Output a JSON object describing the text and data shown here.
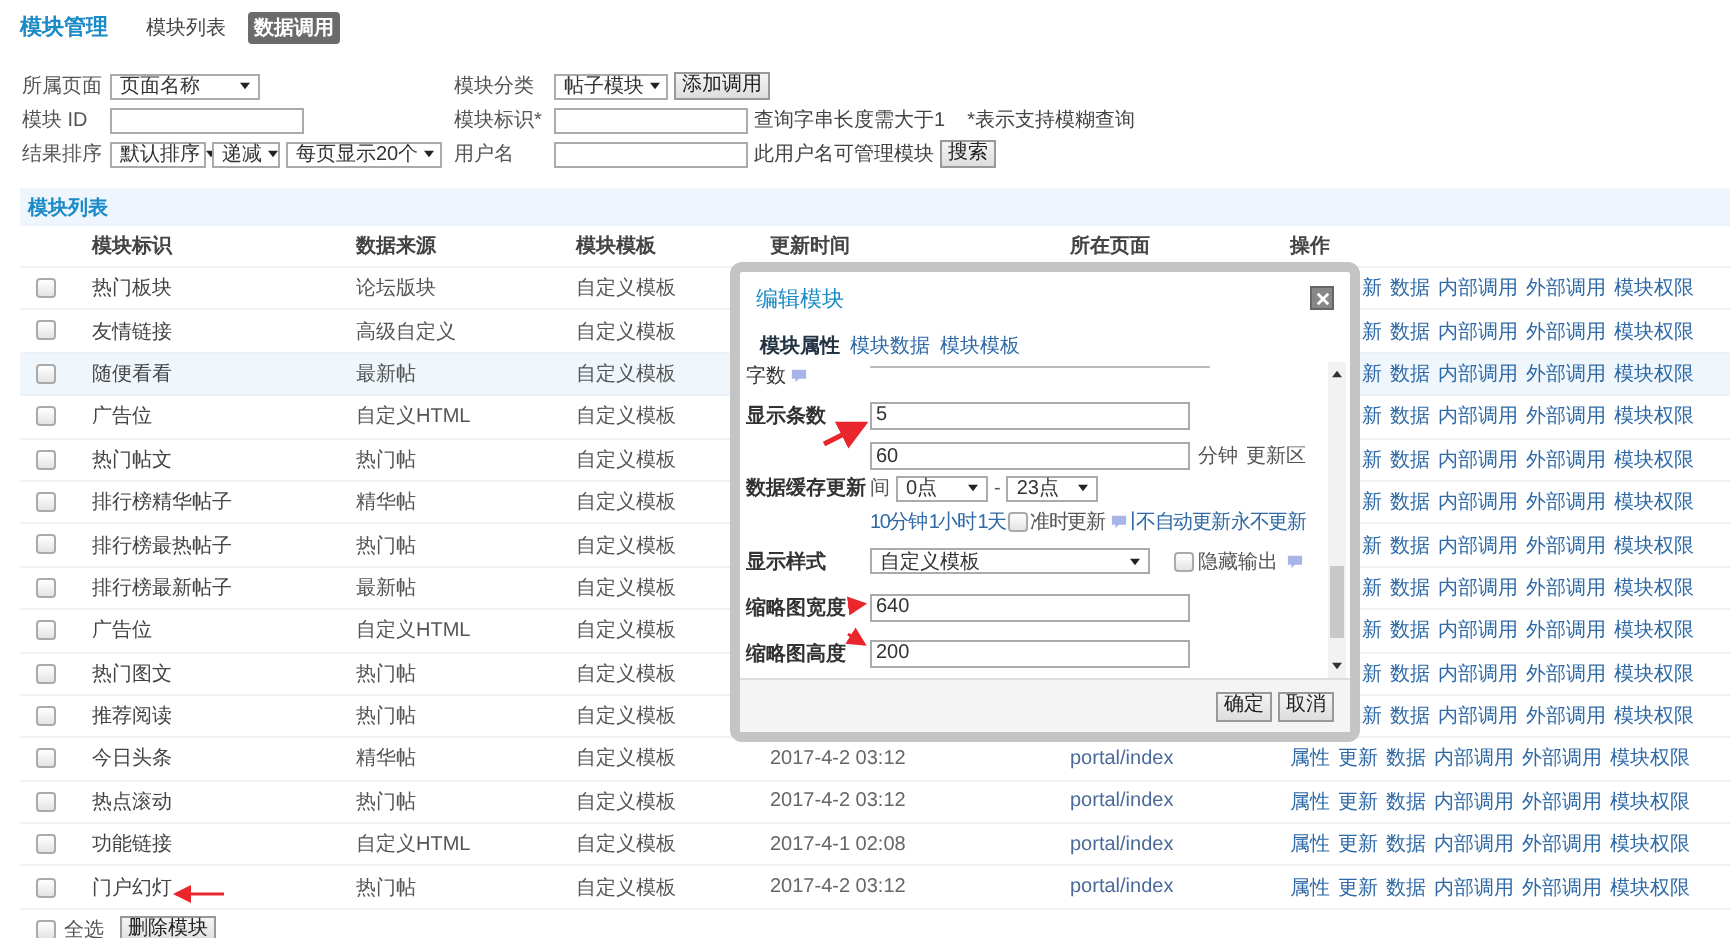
{
  "header": {
    "title": "模块管理",
    "tabs": [
      {
        "label": "模块列表",
        "selected": false
      },
      {
        "label": "数据调用",
        "selected": true
      }
    ]
  },
  "filters": {
    "page_label": "所属页面",
    "page_value": "页面名称",
    "category_label": "模块分类",
    "category_value": "帖子模块",
    "add_button": "添加调用",
    "id_label": "模块 ID",
    "key_label": "模块标识*",
    "key_hint": "查询字串长度需大于1",
    "key_hint_2": "*表示支持模糊查询",
    "sort_label": "结果排序",
    "order_by": "默认排序",
    "direction": "递减",
    "per_page": "每页显示20个",
    "user_label": "用户名",
    "user_hint": "此用户名可管理模块",
    "search_button": "搜索"
  },
  "list": {
    "title": "模块列表",
    "columns": [
      "模块标识",
      "数据来源",
      "模块模板",
      "更新时间",
      "所在页面",
      "操作"
    ],
    "rows": [
      {
        "checked": false,
        "highlighted": false,
        "covered": true,
        "name": "热门板块",
        "source": "论坛版块",
        "template": "自定义模板",
        "actions": [
          "新",
          "数据",
          "内部调用",
          "外部调用",
          "模块权限"
        ]
      },
      {
        "checked": false,
        "highlighted": false,
        "covered": true,
        "name": "友情链接",
        "source": "高级自定义",
        "template": "自定义模板",
        "actions": [
          "新",
          "数据",
          "内部调用",
          "外部调用",
          "模块权限"
        ]
      },
      {
        "checked": false,
        "highlighted": true,
        "covered": true,
        "name": "随便看看",
        "source": "最新帖",
        "template": "自定义模板",
        "actions": [
          "新",
          "数据",
          "内部调用",
          "外部调用",
          "模块权限"
        ]
      },
      {
        "checked": false,
        "highlighted": false,
        "covered": true,
        "name": "广告位",
        "source": "自定义HTML",
        "template": "自定义模板",
        "actions": [
          "新",
          "数据",
          "内部调用",
          "外部调用",
          "模块权限"
        ]
      },
      {
        "checked": false,
        "highlighted": false,
        "covered": true,
        "name": "热门帖文",
        "source": "热门帖",
        "template": "自定义模板",
        "actions": [
          "新",
          "数据",
          "内部调用",
          "外部调用",
          "模块权限"
        ]
      },
      {
        "checked": false,
        "highlighted": false,
        "covered": true,
        "name": "排行榜精华帖子",
        "source": "精华帖",
        "template": "自定义模板",
        "actions": [
          "新",
          "数据",
          "内部调用",
          "外部调用",
          "模块权限"
        ]
      },
      {
        "checked": false,
        "highlighted": false,
        "covered": true,
        "name": "排行榜最热帖子",
        "source": "热门帖",
        "template": "自定义模板",
        "actions": [
          "新",
          "数据",
          "内部调用",
          "外部调用",
          "模块权限"
        ]
      },
      {
        "checked": false,
        "highlighted": false,
        "covered": true,
        "name": "排行榜最新帖子",
        "source": "最新帖",
        "template": "自定义模板",
        "actions": [
          "新",
          "数据",
          "内部调用",
          "外部调用",
          "模块权限"
        ]
      },
      {
        "checked": false,
        "highlighted": false,
        "covered": true,
        "name": "广告位",
        "source": "自定义HTML",
        "template": "自定义模板",
        "actions": [
          "新",
          "数据",
          "内部调用",
          "外部调用",
          "模块权限"
        ]
      },
      {
        "checked": false,
        "highlighted": false,
        "covered": true,
        "name": "热门图文",
        "source": "热门帖",
        "template": "自定义模板",
        "actions": [
          "新",
          "数据",
          "内部调用",
          "外部调用",
          "模块权限"
        ]
      },
      {
        "checked": false,
        "highlighted": false,
        "covered": true,
        "name": "推荐阅读",
        "source": "热门帖",
        "template": "自定义模板",
        "actions": [
          "新",
          "数据",
          "内部调用",
          "外部调用",
          "模块权限"
        ]
      },
      {
        "checked": false,
        "highlighted": false,
        "covered": false,
        "name": "今日头条",
        "source": "精华帖",
        "template": "自定义模板",
        "updated": "2017-4-2 03:12",
        "page": "portal/index",
        "actions": [
          "属性",
          "更新",
          "数据",
          "内部调用",
          "外部调用",
          "模块权限"
        ]
      },
      {
        "checked": false,
        "highlighted": false,
        "covered": false,
        "name": "热点滚动",
        "source": "热门帖",
        "template": "自定义模板",
        "updated": "2017-4-2 03:12",
        "page": "portal/index",
        "actions": [
          "属性",
          "更新",
          "数据",
          "内部调用",
          "外部调用",
          "模块权限"
        ]
      },
      {
        "checked": false,
        "highlighted": false,
        "covered": false,
        "name": "功能链接",
        "source": "自定义HTML",
        "template": "自定义模板",
        "updated": "2017-4-1 02:08",
        "page": "portal/index",
        "actions": [
          "属性",
          "更新",
          "数据",
          "内部调用",
          "外部调用",
          "模块权限"
        ]
      },
      {
        "checked": false,
        "highlighted": false,
        "covered": false,
        "name": "门户幻灯",
        "source": "热门帖",
        "template": "自定义模板",
        "updated": "2017-4-2 03:12",
        "page": "portal/index",
        "actions": [
          "属性",
          "更新",
          "数据",
          "内部调用",
          "外部调用",
          "模块权限"
        ]
      }
    ],
    "select_all": {
      "label": "全选",
      "checked": false
    },
    "delete_button": "删除模块"
  },
  "modal": {
    "title": "编辑模块",
    "tabs": [
      {
        "label": "模块属性",
        "selected": true
      },
      {
        "label": "模块数据",
        "selected": false
      },
      {
        "label": "模块模板",
        "selected": false
      }
    ],
    "fields": [
      {
        "kind": "partial",
        "label": "字数"
      },
      {
        "kind": "input",
        "label": "显示条数",
        "value": "5"
      },
      {
        "kind": "cache",
        "label": "数据缓存更新",
        "value": "60",
        "unit": "分钟",
        "range_label": "更新区",
        "range_label_2": "间",
        "from": "0点",
        "dash": "-",
        "to": "23点",
        "presets": [
          "10分钟",
          "1小时",
          "1天"
        ],
        "on_time": {
          "label": "准时更新",
          "checked": false
        },
        "separator": "|",
        "links": [
          "不自动更新",
          "永不更新"
        ]
      },
      {
        "kind": "select",
        "label": "显示样式",
        "value": "自定义模板",
        "option": {
          "label": "隐藏输出",
          "checked": false
        }
      },
      {
        "kind": "input",
        "label": "缩略图宽度",
        "value": "640"
      },
      {
        "kind": "input",
        "label": "缩略图高度",
        "value": "200"
      }
    ],
    "buttons": [
      "确定",
      "取消"
    ]
  }
}
